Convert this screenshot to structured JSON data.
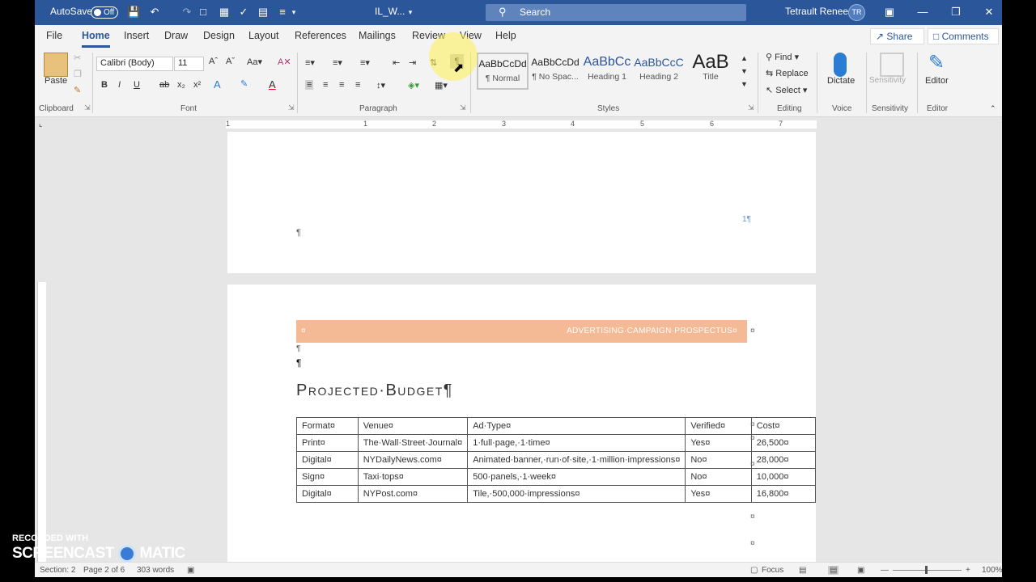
{
  "titlebar": {
    "autosave_label": "AutoSave",
    "autosave_state": "Off",
    "doc_name": "IL_W...",
    "search_placeholder": "Search",
    "user_name": "Tetrault Renee",
    "user_initials": "TR"
  },
  "menu": {
    "tabs": [
      "File",
      "Home",
      "Insert",
      "Draw",
      "Design",
      "Layout",
      "References",
      "Mailings",
      "Review",
      "View",
      "Help"
    ],
    "share": "Share",
    "comments": "Comments"
  },
  "ribbon": {
    "clipboard": {
      "paste": "Paste",
      "label": "Clipboard"
    },
    "font": {
      "family": "Calibri (Body)",
      "size": "11",
      "label": "Font"
    },
    "paragraph": {
      "label": "Paragraph"
    },
    "styles": {
      "label": "Styles",
      "items": [
        {
          "preview": "AaBbCcDd",
          "name": "¶ Normal"
        },
        {
          "preview": "AaBbCcDd",
          "name": "¶ No Spac..."
        },
        {
          "preview": "AaBbCc",
          "name": "Heading 1"
        },
        {
          "preview": "AaBbCcC",
          "name": "Heading 2"
        },
        {
          "preview": "AaB",
          "name": "Title"
        }
      ]
    },
    "editing": {
      "find": "Find",
      "replace": "Replace",
      "select": "Select",
      "label": "Editing"
    },
    "voice": {
      "dictate": "Dictate",
      "label": "Voice"
    },
    "sensitivity": {
      "btn": "Sensitivity",
      "label": "Sensitivity"
    },
    "editor": {
      "btn": "Editor",
      "label": "Editor"
    }
  },
  "ruler": {
    "numbers": [
      "1",
      "1",
      "2",
      "3",
      "4",
      "5",
      "6",
      "7"
    ]
  },
  "page1": {
    "pilcrow": "¶",
    "page_number": "1¶"
  },
  "page2": {
    "header_left": "¤",
    "header_text": "ADVERTISING·CAMPAIGN·PROSPECTUS¤",
    "header_end": "¤",
    "para1": "¶",
    "para2": "¶",
    "title": "Projected·Budget¶",
    "table": {
      "headers": [
        "Format¤",
        "Venue¤",
        "Ad·Type¤",
        "Verified¤",
        "Cost¤"
      ],
      "row_end": "¤",
      "rows": [
        [
          "Print¤",
          "The·Wall·Street·Journal¤",
          "1·full·page,·1·time¤",
          "Yes¤",
          "26,500¤"
        ],
        [
          "Digital¤",
          "NYDailyNews.com¤",
          "Animated·banner,·run·of·site,·1·million·impressions¤",
          "No¤",
          "28,000¤"
        ],
        [
          "Sign¤",
          "Taxi·tops¤",
          "500·panels,·1·week¤",
          "No¤",
          "10,000¤"
        ],
        [
          "Digital¤",
          "NYPost.com¤",
          "Tile,·500,000·impressions¤",
          "Yes¤",
          "16,800¤"
        ]
      ]
    }
  },
  "status": {
    "section": "Section: 2",
    "page": "Page 2 of 6",
    "words": "303 words",
    "focus": "Focus",
    "zoom": "100%"
  },
  "watermark": {
    "line1": "RECORDED WITH",
    "line2": "SCREENCAST",
    "line3": "MATIC"
  }
}
